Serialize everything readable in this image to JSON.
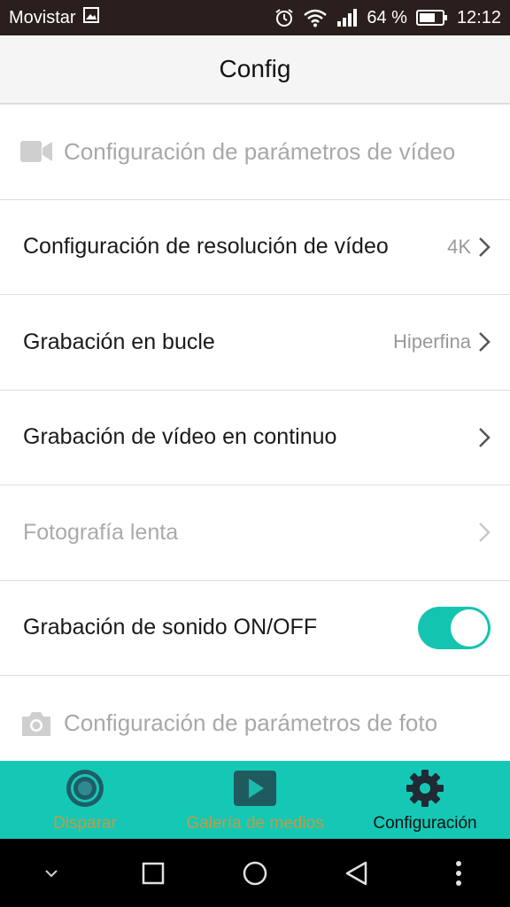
{
  "status_bar": {
    "carrier": "Movistar",
    "battery_percent": "64 %",
    "time": "12:12"
  },
  "header": {
    "title": "Config"
  },
  "rows": {
    "video_section": "Configuración de parámetros de vídeo",
    "video_resolution": {
      "label": "Configuración de resolución de vídeo",
      "value": "4K"
    },
    "loop_recording": {
      "label": "Grabación en bucle",
      "value": "Hiperfina"
    },
    "continuous_video": {
      "label": "Grabación de vídeo en continuo"
    },
    "slow_photo": {
      "label": "Fotografía lenta"
    },
    "sound_recording": {
      "label": "Grabación de sonido ON/OFF",
      "enabled": true
    },
    "photo_section": "Configuración de parámetros de foto"
  },
  "tabbar": {
    "tabs": [
      {
        "label": "Disparar",
        "icon": "shutter-icon",
        "active": false
      },
      {
        "label": "Galería de medios",
        "icon": "play-icon",
        "active": false
      },
      {
        "label": "Configuración",
        "icon": "gear-icon",
        "active": true
      }
    ]
  },
  "colors": {
    "accent": "#15c8b5",
    "toggle_on": "#13c5b1",
    "inactive_tab_label": "#c49a45",
    "status_bar": "#2a1f1d"
  },
  "navbar": {
    "buttons": [
      "collapse-icon",
      "recents-icon",
      "home-icon",
      "back-icon",
      "more-icon"
    ]
  }
}
